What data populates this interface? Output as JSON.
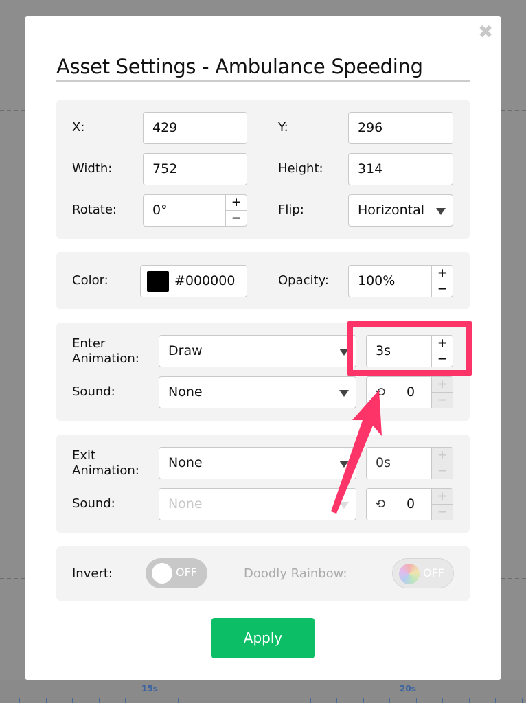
{
  "dialog": {
    "title": "Asset Settings - Ambulance Speeding",
    "close_icon": "close-x-icon"
  },
  "geometry": {
    "x_label": "X:",
    "x_value": "429",
    "y_label": "Y:",
    "y_value": "296",
    "width_label": "Width:",
    "width_value": "752",
    "height_label": "Height:",
    "height_value": "314",
    "rotate_label": "Rotate:",
    "rotate_value": "0°",
    "flip_label": "Flip:",
    "flip_value": "Horizontal"
  },
  "appearance": {
    "color_label": "Color:",
    "color_value": "#000000",
    "opacity_label": "Opacity:",
    "opacity_value": "100%"
  },
  "enter": {
    "label_line1": "Enter",
    "label_line2": "Animation:",
    "animation": "Draw",
    "duration": "3s",
    "sound_label": "Sound:",
    "sound": "None",
    "loop_count": "0"
  },
  "exit": {
    "label_line1": "Exit",
    "label_line2": "Animation:",
    "animation": "None",
    "duration": "0s",
    "sound_label": "Sound:",
    "sound": "None",
    "loop_count": "0"
  },
  "toggles": {
    "invert_label": "Invert:",
    "invert_state": "OFF",
    "rainbow_label": "Doodly Rainbow:",
    "rainbow_state": "OFF"
  },
  "stepper": {
    "plus": "+",
    "minus": "−"
  },
  "apply_label": "Apply",
  "timeline": {
    "labels": [
      "15s",
      "20s"
    ]
  },
  "colors": {
    "accent_green": "#0cbf66",
    "highlight_pink": "#fd3468"
  }
}
